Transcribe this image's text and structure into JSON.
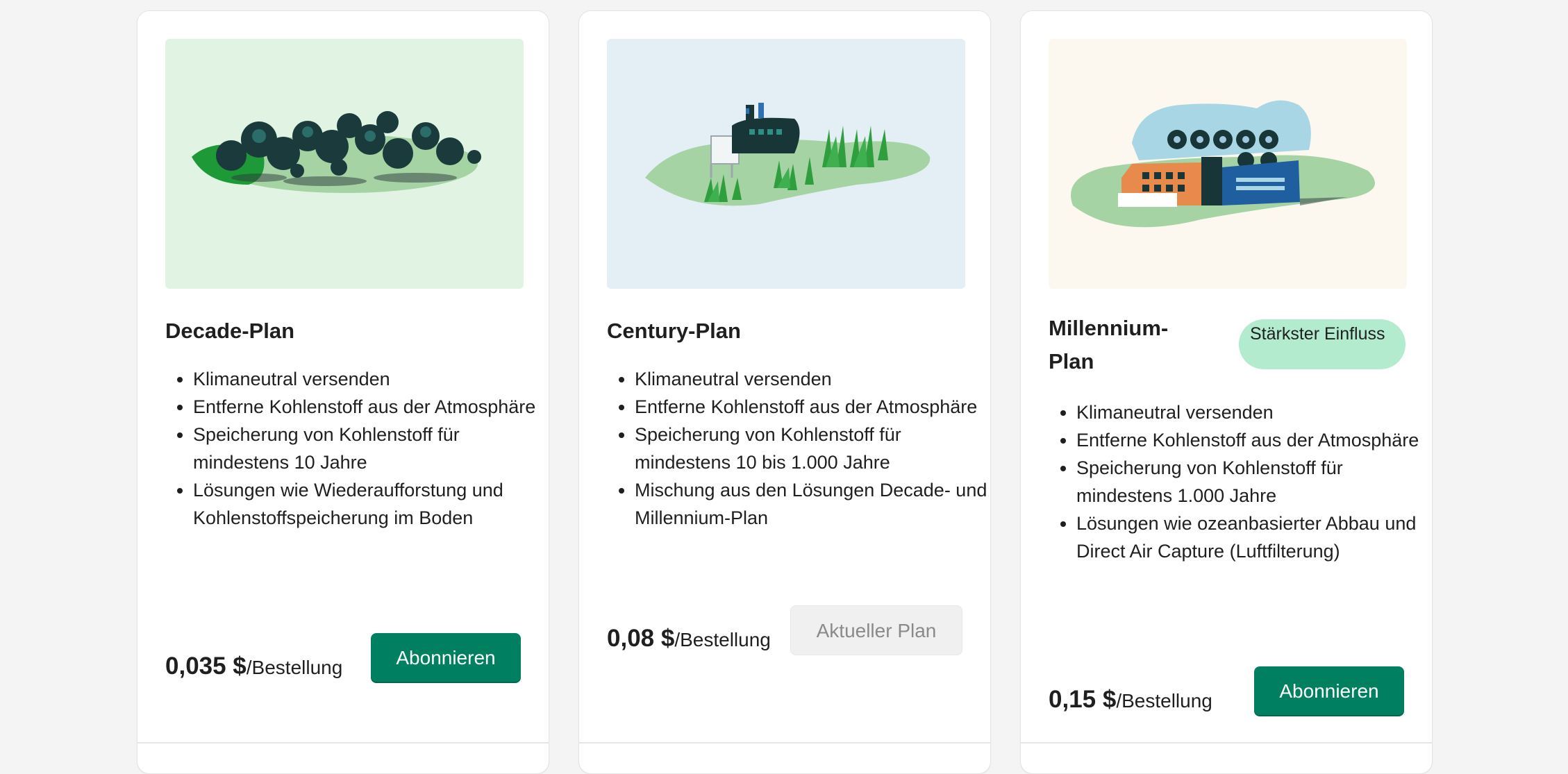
{
  "plans": [
    {
      "name": "Decade-Plan",
      "image_icon": "reforestation-illustration",
      "features": [
        "Klimaneutral versenden",
        "Entferne Kohlenstoff aus der Atmosphäre",
        "Speicherung von Kohlenstoff für mindestens 10 Jahre",
        "Lösungen wie Wiederaufforstung und Kohlenstoffspeicherung im Boden"
      ],
      "price": "0,035 $",
      "price_unit": "/Bestellung",
      "button_label": "Abonnieren"
    },
    {
      "name": "Century-Plan",
      "image_icon": "mixed-solutions-illustration",
      "features": [
        "Klimaneutral versenden",
        "Entferne Kohlenstoff aus der Atmosphäre",
        "Speicherung von Kohlenstoff für mindestens 10 bis 1.000 Jahre",
        "Mischung aus den Lösungen Decade- und Millennium-Plan"
      ],
      "price": "0,08 $",
      "price_unit": "/Bestellung",
      "button_label": "Aktueller Plan"
    },
    {
      "name": "Millennium-Plan",
      "badge": "Stärkster Einfluss",
      "image_icon": "direct-air-capture-illustration",
      "features": [
        "Klimaneutral versenden",
        "Entferne Kohlenstoff aus der Atmosphäre",
        "Speicherung von Kohlenstoff für mindestens 1.000 Jahre",
        "Lösungen wie ozeanbasierter Abbau und Direct Air Capture (Luftfilterung)"
      ],
      "price": "0,15 $",
      "price_unit": "/Bestellung",
      "button_label": "Abonnieren"
    }
  ],
  "colors": {
    "primary": "#008060",
    "badge": "#b2ebce",
    "decade_bg": "#e1f4e3",
    "century_bg": "#e3eff5",
    "millennium_bg": "#fcf8f0"
  }
}
